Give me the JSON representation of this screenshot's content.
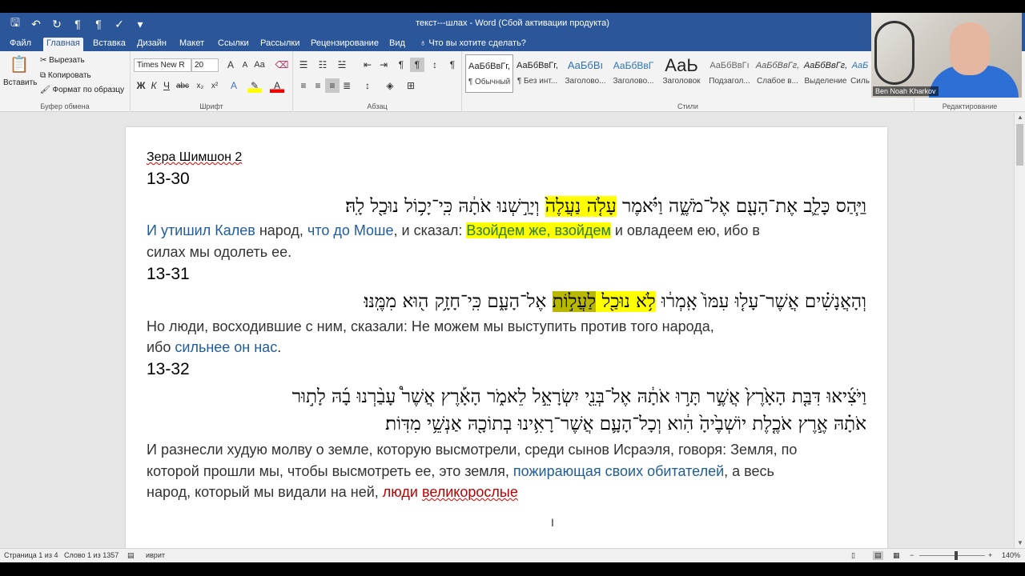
{
  "window": {
    "title": "текст---шлах - Word (Сбой активации продукта)"
  },
  "tabs": [
    "Файл",
    "Главная",
    "Вставка",
    "Дизайн",
    "Макет",
    "Ссылки",
    "Рассылки",
    "Рецензирование",
    "Вид"
  ],
  "tell_me": "Что вы хотите сделать?",
  "ribbon": {
    "clipboard": {
      "paste": "Вставить",
      "cut": "Вырезать",
      "copy": "Копировать",
      "format_painter": "Формат по образцу",
      "label": "Буфер обмена"
    },
    "font": {
      "font_name": "Times New R",
      "font_size": "20",
      "bold": "Ж",
      "italic": "К",
      "underline": "Ч",
      "label": "Шрифт"
    },
    "paragraph": {
      "label": "Абзац"
    },
    "styles": {
      "label": "Стили",
      "items": [
        {
          "preview": "АаБбВвГг,",
          "name": "¶ Обычный"
        },
        {
          "preview": "АаБбВвГг,",
          "name": "¶ Без инт..."
        },
        {
          "preview": "АаБбВı",
          "name": "Заголово..."
        },
        {
          "preview": "АаБбВвГ",
          "name": "Заголово..."
        },
        {
          "preview": "АаЬ",
          "name": "Заголовок"
        },
        {
          "preview": "АаБбВвГı",
          "name": "Подзагол..."
        },
        {
          "preview": "АаБбВвГг,",
          "name": "Слабое в..."
        },
        {
          "preview": "АаБбВвГг,",
          "name": "Выделение"
        },
        {
          "preview": "АаБ",
          "name": "Силь"
        }
      ]
    },
    "editing": {
      "label": "Редактирование"
    }
  },
  "webcam": {
    "name": "Ben Noah Kharkov"
  },
  "document": {
    "heading": "Зера Шимшон 2",
    "v30": {
      "num": "13-30",
      "he_before": "וַיַּ֧הַס כָּלֵ֛ב אֶת־הָעָ֖ם אֶל־מֹשֶׁ֑ה וַיֹּ֗אמֶר ",
      "he_hl": "עָלֹ֤ה נַעֲלֶה֙",
      "he_after": " וְיָרַ֣שְׁנוּ אֹתָ֔הּ כִּֽי־יָכ֥וֹל נוּכַ֖ל לָֽהּ׃",
      "ru1_a": "И утишил Калев",
      "ru1_b": " народ, ",
      "ru1_c": "что до Моше",
      "ru1_d": ", и сказал: ",
      "ru1_e": "Взойдем же, взойдем",
      "ru1_f": " и овладеем ею, ибо в",
      "ru2": "силах мы одолеть ее."
    },
    "v31": {
      "num": "13-31",
      "he_before": "וְהָאֲנָשִׁ֗ים אֲשֶׁר־עָל֤וּ עִמּוֹ֙ אָֽמְר֔וּ ",
      "he_hl1": "לֹ֥א נוּכַ֖ל",
      "he_mid": " ",
      "he_hl2": "לַעֲל֣וֹת",
      "he_after": " אֶל־הָעָ֑ם כִּֽי־חָזָ֥ק ה֖וּא מִמֶּֽנּוּ׃",
      "ru1": "Но люди, восходившие с ним, сказали: Не можем мы выступить против того народа,",
      "ru2_a": "ибо ",
      "ru2_b": "сильнее он нас",
      "ru2_c": "."
    },
    "v32": {
      "num": "13-32",
      "he1": "וַיֹּצִ֜יאוּ דִּבַּ֤ת הָאָ֙רֶץ֙ אֲשֶׁ֣ר תָּר֣וּ אֹתָ֔הּ אֶל־בְּנֵ֖י יִשְׂרָאֵ֣ל לֵאמֹ֑ר הָאָ֡רֶץ אֲשֶׁר֩ עָבַ֨רְנוּ בָ֜הּ לָת֣וּר",
      "he2": "אֹתָ֗הּ אֶ֣רֶץ אֹכֶ֤לֶת יוֹשְׁבֶ֙יהָ֙ הִ֔וא וְכָל־הָעָ֛ם אֲשֶׁר־רָאִ֥ינוּ בְתוֹכָ֖הּ אַנְשֵׁ֥י מִדּֽוֹת׃",
      "ru1": "И разнесли худую молву о земле, которую высмотрели, среди сынов Исраэля, говоря: Земля, по",
      "ru2_a": "которой прошли мы, чтобы высмотреть ее, это земля, ",
      "ru2_b": "пожирающая своих обитателей",
      "ru2_c": ", а весь",
      "ru3_a": "народ, который мы видали на ней, ",
      "ru3_b": "люди ",
      "ru3_c": "великорослые"
    }
  },
  "status": {
    "page": "Страница 1 из 4",
    "words": "Слово 1 из 1357",
    "language": "иврит",
    "zoom": "140%"
  },
  "colors": {
    "title_bar": "#2b579a",
    "highlight_yellow": "#ffff00",
    "highlight_dark": "#b8b800",
    "text_blue": "#1f5c9a",
    "text_red": "#c00000"
  }
}
